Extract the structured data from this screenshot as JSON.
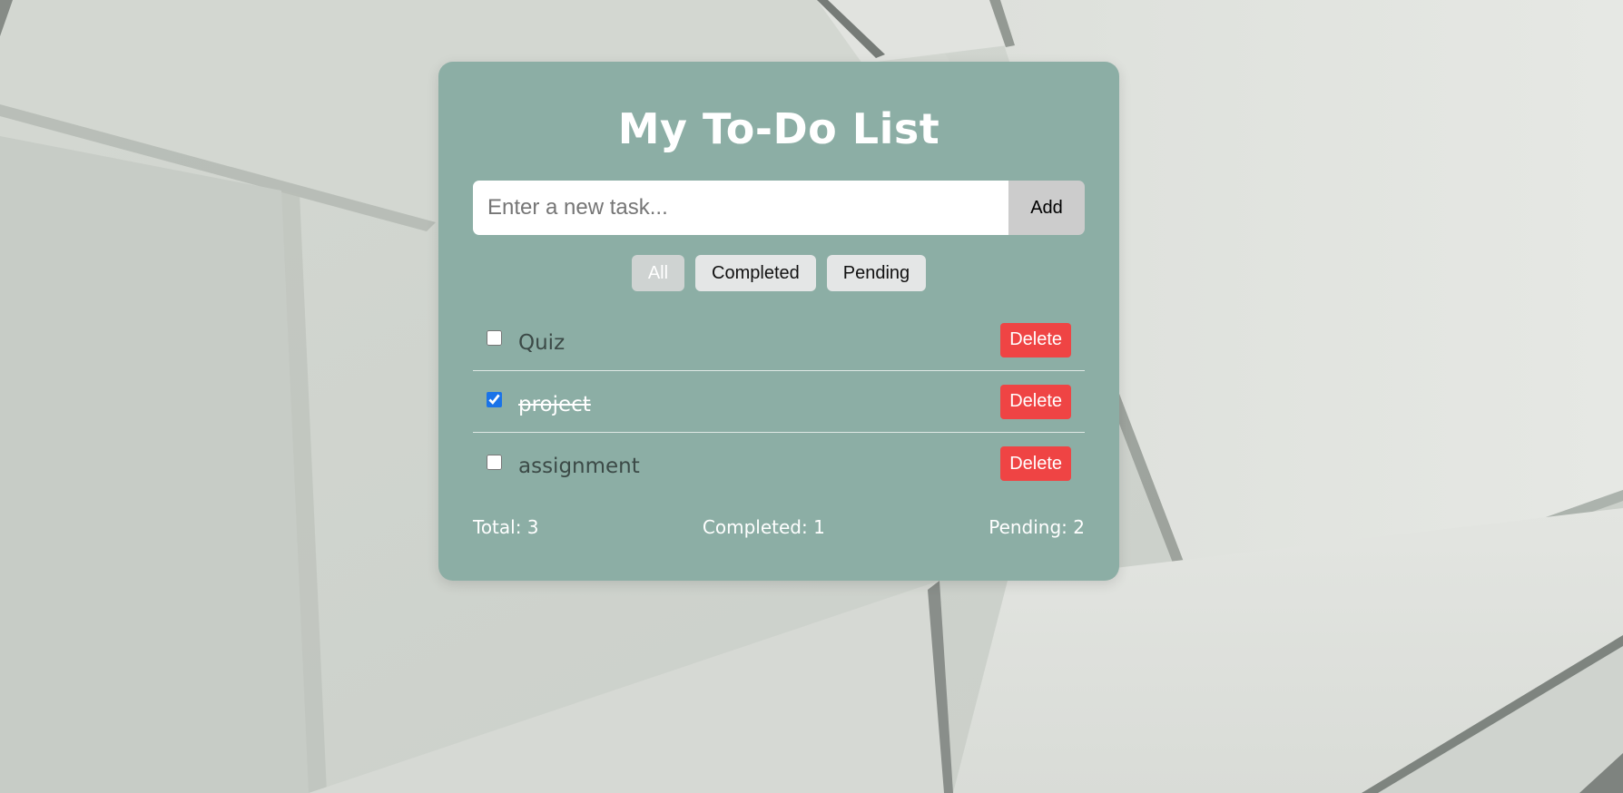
{
  "app": {
    "title": "My To-Do List"
  },
  "input": {
    "placeholder": "Enter a new task...",
    "value": ""
  },
  "add_button": {
    "label": "Add"
  },
  "filters": [
    {
      "label": "All",
      "active": true
    },
    {
      "label": "Completed",
      "active": false
    },
    {
      "label": "Pending",
      "active": false
    }
  ],
  "tasks": [
    {
      "text": "Quiz",
      "completed": false,
      "delete_label": "Delete"
    },
    {
      "text": "project",
      "completed": true,
      "delete_label": "Delete"
    },
    {
      "text": "assignment",
      "completed": false,
      "delete_label": "Delete"
    }
  ],
  "stats": {
    "total": "Total: 3",
    "completed": "Completed: 1",
    "pending": "Pending: 2"
  },
  "colors": {
    "card_bg": "#8caea5",
    "delete_button": "#ef4444",
    "add_button": "#cccccc",
    "checkbox_accent": "#1a73e8"
  },
  "icons": {
    "checkbox": "checkbox-icon"
  }
}
